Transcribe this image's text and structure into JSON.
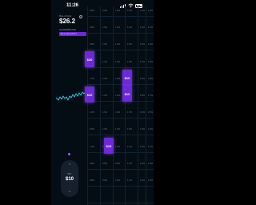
{
  "status_bar": {
    "time": "11:26",
    "battery": "73"
  },
  "header": {
    "balance_label": "BALANCE",
    "balance_value": "$26.2",
    "leaderboard_label": "LEADERBOARD",
    "leaderboard_badge": "Set a name first ✎"
  },
  "grid": {
    "columns": [
      [
        "0.8%",
        "0.8%",
        "0.8%",
        "1.1%",
        "1.2%",
        "1.1%",
        "1.0%",
        "0.9%",
        "1.0%",
        "0.8%",
        "0.8%"
      ],
      [
        "0.9%",
        "1.0%",
        "1.0%",
        "1.1%",
        "1.3%",
        "1.2%",
        "1.1%",
        "1.0%",
        "0.8%",
        "0.8%",
        "0.9%"
      ],
      [
        "1.0%",
        "1.1%",
        "1.2%",
        "1.4%",
        "1.6%",
        "1.5%",
        "1.4%",
        "1.2%",
        "1.0%",
        "0.9%",
        "1.0%"
      ],
      [
        "1.2%",
        "1.4%",
        "1.5%",
        "1.8%",
        "2.0%",
        "1.9%",
        "1.7%",
        "1.5%",
        "1.2%",
        "1.1%",
        "1.1%"
      ],
      [
        "1.1%",
        "1.3%",
        "1.5%",
        "1.7%",
        "1.9%",
        "1.8%",
        "1.6%",
        "1.4%",
        "1.2%",
        "1.0%",
        "1.1%"
      ],
      [
        "1.0%",
        "1.2%",
        "1.4%",
        "1.6%",
        "1.8%",
        "1.7%",
        "1.5%",
        "1.3%",
        "1.1%",
        "1.0%",
        "1.0%"
      ]
    ]
  },
  "bets": [
    {
      "label": "$10"
    },
    {
      "label": "$10"
    },
    {
      "label": "$10"
    },
    {
      "label": "$10"
    },
    {
      "label": "$10"
    }
  ],
  "stake": {
    "label": "BET",
    "amount": "$10"
  },
  "colors": {
    "accent": "#6d28d9",
    "wave": "#22d3ee",
    "background": "#050d14"
  }
}
